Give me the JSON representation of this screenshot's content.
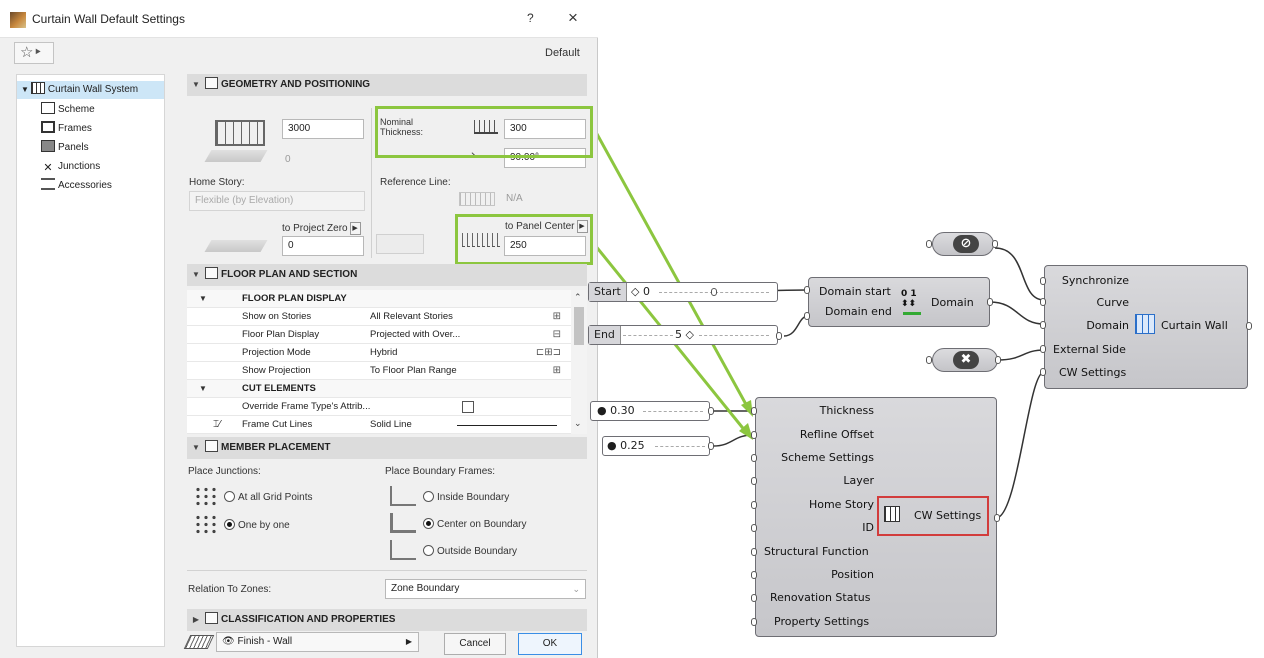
{
  "dialog": {
    "title": "Curtain Wall Default Settings",
    "help": "?",
    "close": "×",
    "favorites_icon": "☆‣",
    "preset_label": "Default",
    "tree": [
      {
        "label": "Curtain Wall System",
        "selected": true
      },
      {
        "label": "Scheme"
      },
      {
        "label": "Frames"
      },
      {
        "label": "Panels"
      },
      {
        "label": "Junctions"
      },
      {
        "label": "Accessories"
      }
    ],
    "geometry": {
      "header": "GEOMETRY AND POSITIONING",
      "height_value": "3000",
      "bottom_offset": "0",
      "nominal_thickness_label": "Nominal\nThickness:",
      "thickness_value": "300",
      "angle_value": "90.00°",
      "home_story_label": "Home Story:",
      "home_story_value": "Flexible (by Elevation)",
      "reference_line_label": "Reference Line:",
      "reference_line_value": "N/A",
      "to_project_zero": "to Project Zero",
      "project_zero_value": "0",
      "to_panel_center": "to Panel Center",
      "panel_center_value": "250"
    },
    "floor_plan": {
      "header": "FLOOR PLAN AND SECTION",
      "rows": [
        {
          "kind": "hdr",
          "c1": "FLOOR PLAN DISPLAY"
        },
        {
          "c1": "Show on Stories",
          "c2": "All Relevant Stories"
        },
        {
          "c1": "Floor Plan Display",
          "c2": "Projected with Over..."
        },
        {
          "c1": "Projection Mode",
          "c2": "Hybrid"
        },
        {
          "c1": "Show Projection",
          "c2": "To Floor Plan Range"
        },
        {
          "kind": "hdr",
          "c1": "CUT ELEMENTS"
        },
        {
          "c1": "Override Frame Type's Attrib..."
        },
        {
          "c1": "Frame Cut Lines",
          "c2": "Solid Line"
        }
      ]
    },
    "member": {
      "header": "MEMBER PLACEMENT",
      "place_junctions": "Place Junctions:",
      "place_boundary": "Place Boundary Frames:",
      "at_all_grid": "At all Grid Points",
      "one_by_one": "One by one",
      "inside": "Inside Boundary",
      "center": "Center on Boundary",
      "outside": "Outside Boundary",
      "relation_label": "Relation To Zones:",
      "relation_value": "Zone Boundary"
    },
    "classification_header": "CLASSIFICATION AND PROPERTIES",
    "layer_value": "Finish - Wall",
    "cancel": "Cancel",
    "ok": "OK"
  },
  "gh": {
    "slider_start": {
      "label": "Start",
      "value": "0"
    },
    "slider_end": {
      "label": "End",
      "value": "5"
    },
    "slider_thickness": {
      "value": "0.30"
    },
    "slider_offset": {
      "value": "0.25"
    },
    "domain": {
      "in1": "Domain start",
      "in2": "Domain end",
      "out": "Domain"
    },
    "curtain_wall": {
      "in": [
        "Synchronize",
        "Curve",
        "Domain",
        "External Side",
        "CW Settings"
      ],
      "out": "Curtain Wall"
    },
    "cw_settings": {
      "in": [
        "Thickness",
        "Refline Offset",
        "Scheme Settings",
        "Layer",
        "Home Story",
        "ID",
        "Structural Function",
        "Position",
        "Renovation Status",
        "Property Settings"
      ],
      "out": "CW Settings"
    }
  },
  "colors": {
    "highlight_green": "#8cc63f",
    "highlight_red": "#d23c3c"
  }
}
